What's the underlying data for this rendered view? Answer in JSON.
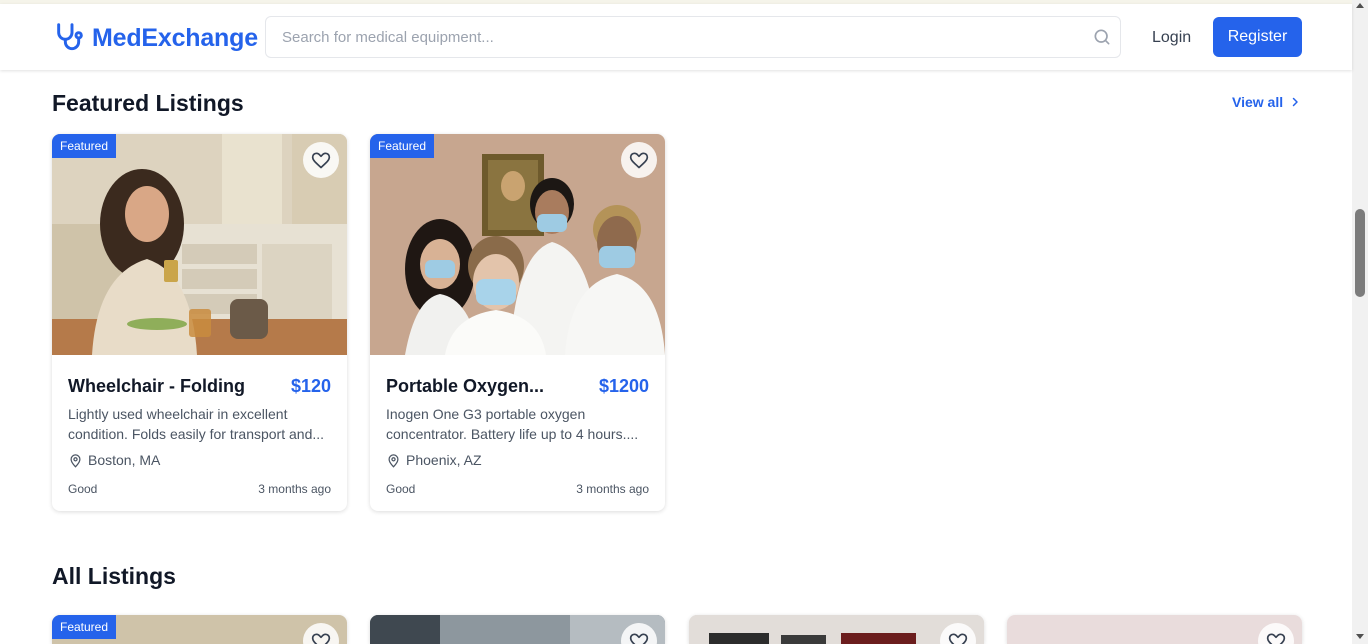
{
  "brand": {
    "name": "MedExchange",
    "icon": "stethoscope-icon"
  },
  "search": {
    "placeholder": "Search for medical equipment...",
    "value": ""
  },
  "nav": {
    "login": "Login",
    "register": "Register"
  },
  "featured": {
    "title": "Featured Listings",
    "view_all": "View all",
    "cards": [
      {
        "badge": "Featured",
        "title": "Wheelchair - Folding",
        "price": "$120",
        "description": "Lightly used wheelchair in excellent condition. Folds easily for transport and...",
        "location": "Boston, MA",
        "condition": "Good",
        "time": "3 months ago"
      },
      {
        "badge": "Featured",
        "title": "Portable Oxygen...",
        "price": "$1200",
        "description": "Inogen One G3 portable oxygen concentrator. Battery life up to 4 hours....",
        "location": "Phoenix, AZ",
        "condition": "Good",
        "time": "3 months ago"
      }
    ]
  },
  "all": {
    "title": "All Listings",
    "cards": [
      {
        "badge": "Featured"
      },
      {
        "badge": ""
      },
      {
        "badge": ""
      },
      {
        "badge": ""
      }
    ]
  },
  "colors": {
    "accent": "#2563eb",
    "text": "#111827",
    "muted": "#4b5563"
  }
}
